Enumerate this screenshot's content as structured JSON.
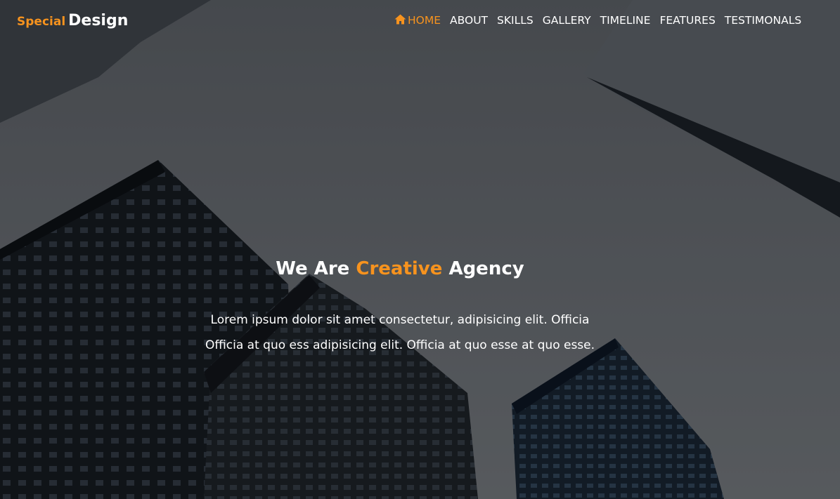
{
  "brand": {
    "prefix": "Special",
    "name": "Design"
  },
  "nav": {
    "items": [
      {
        "label": "HOME",
        "icon": "home-icon",
        "active": true
      },
      {
        "label": "ABOUT"
      },
      {
        "label": "SKILLS"
      },
      {
        "label": "GALLERY"
      },
      {
        "label": "TIMELINE"
      },
      {
        "label": "FEATURES"
      },
      {
        "label": "TESTIMONALS"
      }
    ]
  },
  "hero": {
    "title_pre": "We Are",
    "title_accent": "Creative",
    "title_post": "Agency",
    "text": "Lorem ipsum dolor sit amet consectetur, adipisicing elit. Officia Officia at quo ess adipisicing elit. Officia at quo esse at quo esse."
  },
  "colors": {
    "accent": "#f7931e",
    "text": "#ffffff",
    "overlay": "rgba(0,0,0,0.35)"
  }
}
